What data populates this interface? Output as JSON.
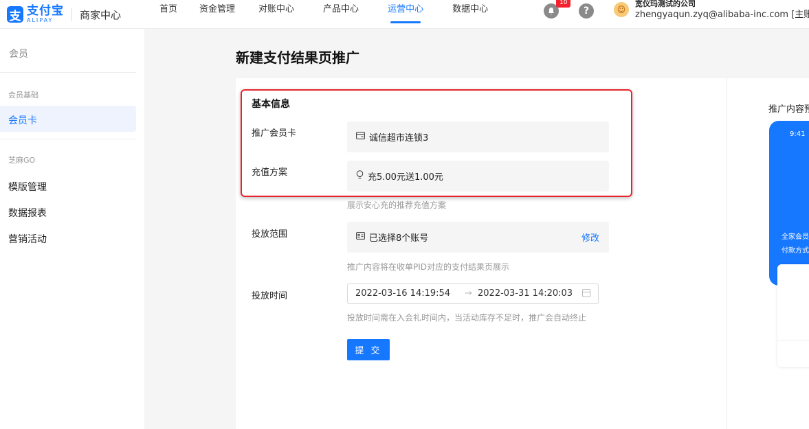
{
  "header": {
    "logo_glyph": "支",
    "logo_cn": "支付宝",
    "logo_en": "ALIPAY",
    "biz_center": "商家中心",
    "nav": [
      {
        "label": "首页",
        "active": false
      },
      {
        "label": "资金管理",
        "active": false
      },
      {
        "label": "对账中心",
        "active": false
      },
      {
        "label": "产品中心",
        "active": false
      },
      {
        "label": "运营中心",
        "active": true
      },
      {
        "label": "数据中心",
        "active": false
      }
    ],
    "notification_badge": "10",
    "help_glyph": "?",
    "company_name": "宽仪玛测试的公司",
    "account": "zhengyaqun.zyq@alibaba-inc.com [主账号]"
  },
  "sidebar": {
    "title": "会员",
    "group1": "会员基础",
    "item_member_card": "会员卡",
    "group2": "芝麻GO",
    "items": [
      "模版管理",
      "数据报表",
      "营销活动"
    ]
  },
  "page": {
    "title": "新建支付结果页推广",
    "section_title": "基本信息",
    "member_card_label": "推广会员卡",
    "member_card_value": "诚信超市连锁3",
    "recharge_label": "充值方案",
    "recharge_value": "充5.00元送1.00元",
    "recharge_hint": "展示安心充的推荐充值方案",
    "scope_label": "投放范围",
    "scope_value": "已选择8个账号",
    "scope_edit": "修改",
    "scope_hint": "推广内容将在收单PID对应的支付结果页展示",
    "time_label": "投放时间",
    "time_start": "2022-03-16 14:19:54",
    "time_end": "2022-03-31 14:20:03",
    "time_arrow": "→",
    "time_hint": "投放时间需在入会礼时间内，当活动库存不足时，推广会自动终止",
    "submit": "提 交"
  },
  "preview": {
    "title": "推广内容预",
    "phone_time": "9:41",
    "phone_text1": "全家会员",
    "phone_text2": "付款方式"
  },
  "colors": {
    "brand_blue": "#1677ff",
    "highlight_red": "#e5242c"
  }
}
